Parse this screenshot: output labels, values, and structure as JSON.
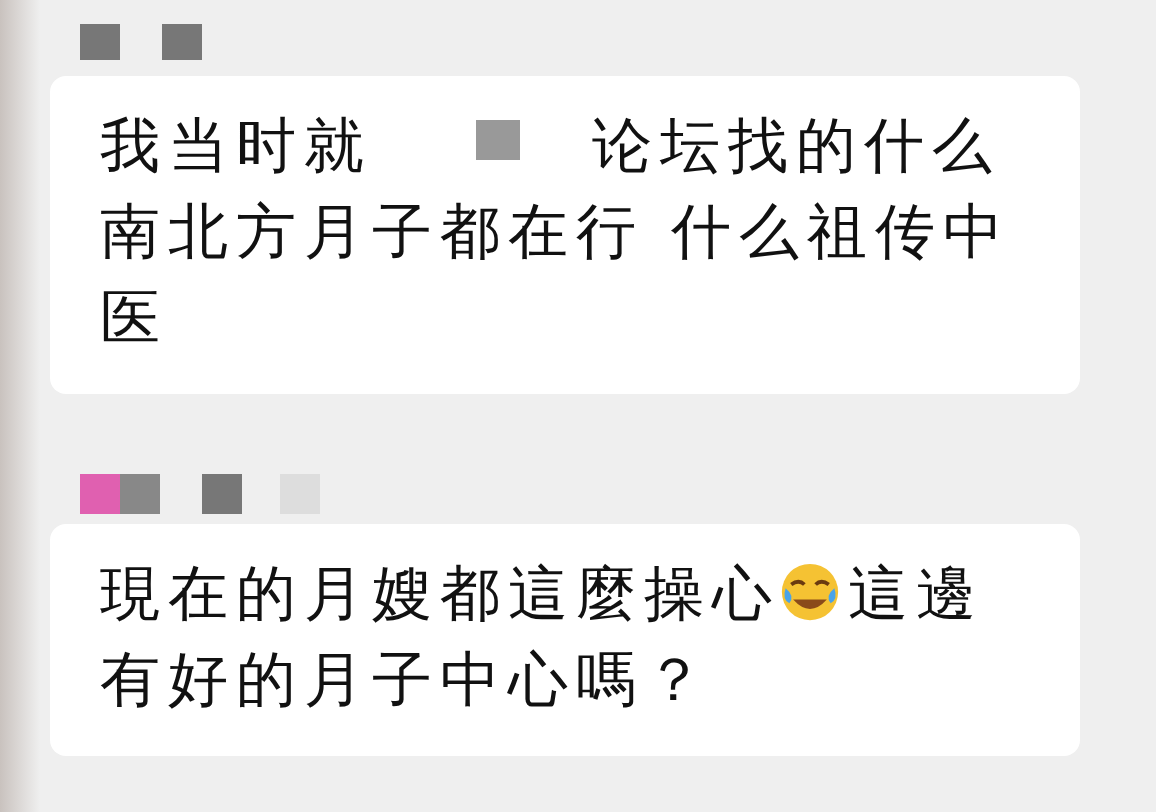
{
  "comments": [
    {
      "lines": [
        [
          {
            "kind": "text",
            "text": "我当时就"
          },
          {
            "kind": "redacted"
          },
          {
            "kind": "text",
            "text": "论坛找的什么"
          }
        ],
        [
          {
            "kind": "text",
            "text": "南北方月子都在行 什么祖传中"
          }
        ],
        [
          {
            "kind": "text",
            "text": "医"
          }
        ]
      ]
    },
    {
      "lines": [
        [
          {
            "kind": "text",
            "text": "現在的月嫂都這麼操心"
          },
          {
            "kind": "emoji"
          },
          {
            "kind": "text",
            "text": "這邊"
          }
        ],
        [
          {
            "kind": "text",
            "text": "有好的月子中心嗎？"
          }
        ]
      ]
    }
  ]
}
